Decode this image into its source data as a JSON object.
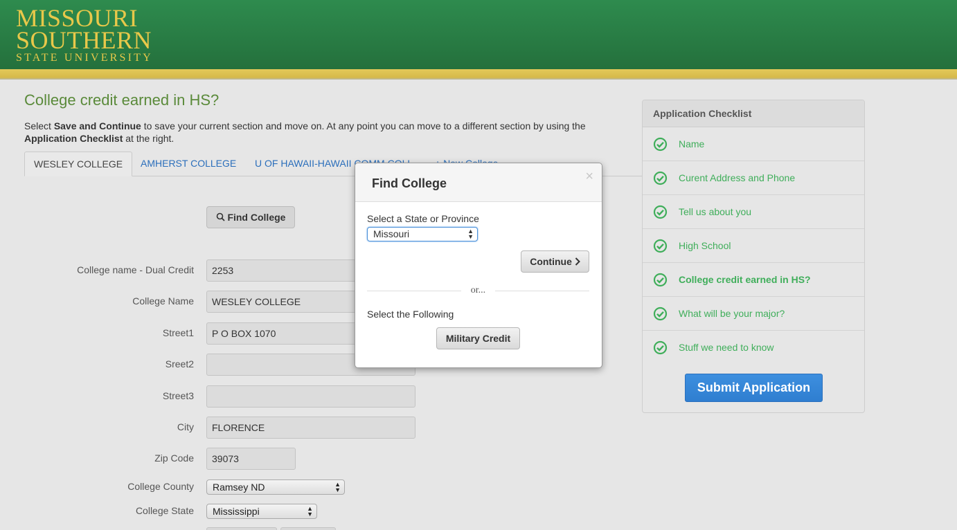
{
  "brand": {
    "line1": "MISSOURI",
    "line2": "SOUTHERN",
    "line3": "STATE UNIVERSITY",
    "primary_green": "#2e8b4e",
    "gold": "#e8c84a"
  },
  "page": {
    "title": "College credit earned in HS?",
    "intro": {
      "p1": "Select ",
      "b1": "Save and Continue",
      "p2": " to save your current section and move on. At any point you can move to a different section by using the ",
      "b2": "Application Checklist",
      "p3": " at the right."
    }
  },
  "tabs": [
    {
      "label": "WESLEY COLLEGE",
      "active": true
    },
    {
      "label": "AMHERST COLLEGE",
      "active": false
    },
    {
      "label": "U OF HAWAII-HAWAII COMM COLL",
      "active": false
    },
    {
      "label": "+ New College",
      "active": false
    }
  ],
  "form": {
    "find_button": "Find College",
    "fields": [
      {
        "label": "College name - Dual Credit",
        "value": "2253"
      },
      {
        "label": "College Name",
        "value": "WESLEY COLLEGE"
      },
      {
        "label": "Street1",
        "value": "P O BOX 1070"
      },
      {
        "label": "Sreet2",
        "value": ""
      },
      {
        "label": "Street3",
        "value": ""
      },
      {
        "label": "City",
        "value": "FLORENCE"
      },
      {
        "label": "Zip Code",
        "value": "39073"
      }
    ],
    "county": {
      "label": "College County",
      "value": "Ramsey ND"
    },
    "state": {
      "label": "College State",
      "value": "Mississippi"
    }
  },
  "modal": {
    "title": "Find College",
    "close_glyph": "×",
    "state_label": "Select a State or Province",
    "state_value": "Missouri",
    "continue_label": "Continue",
    "or_text": "or...",
    "following_label": "Select the Following",
    "military_label": "Military Credit"
  },
  "checklist": {
    "title": "Application Checklist",
    "items": [
      {
        "label": "Name",
        "icon": "check-circle-icon"
      },
      {
        "label": "Curent Address and Phone",
        "icon": "check-circle-icon"
      },
      {
        "label": "Tell us about you",
        "icon": "check-circle-icon"
      },
      {
        "label": "High School",
        "icon": "check-circle-icon"
      },
      {
        "label": "College credit earned in HS?",
        "icon": "check-circle-icon",
        "current": true
      },
      {
        "label": "What will be your major?",
        "icon": "check-circle-icon"
      },
      {
        "label": "Stuff we need to know",
        "icon": "check-circle-icon"
      }
    ],
    "submit_label": "Submit Application",
    "check_color": "#3fae5a"
  }
}
